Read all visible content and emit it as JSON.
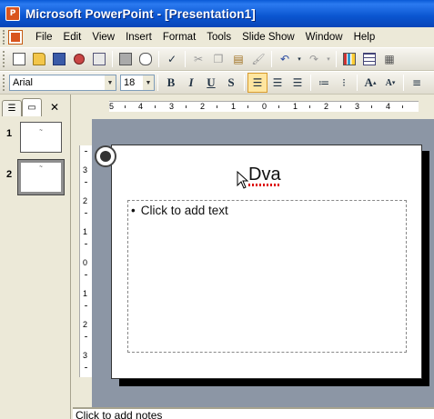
{
  "window": {
    "title": "Microsoft PowerPoint - [Presentation1]",
    "icon": "powerpoint-app-icon"
  },
  "menubar": {
    "items": [
      {
        "label": "File"
      },
      {
        "label": "Edit"
      },
      {
        "label": "View"
      },
      {
        "label": "Insert"
      },
      {
        "label": "Format"
      },
      {
        "label": "Tools"
      },
      {
        "label": "Slide Show"
      },
      {
        "label": "Window"
      },
      {
        "label": "Help"
      }
    ]
  },
  "toolbar_standard": {
    "icons": [
      "new-icon",
      "open-icon",
      "save-icon",
      "permission-icon",
      "email-icon",
      "print-icon",
      "print-preview-icon",
      "spelling-icon",
      "cut-icon",
      "copy-icon",
      "paste-icon",
      "format-painter-icon",
      "undo-icon",
      "redo-icon",
      "insert-chart-icon",
      "insert-table-icon",
      "tables-borders-icon"
    ]
  },
  "toolbar_formatting": {
    "font_name": "Arial",
    "font_size": "18",
    "bold": "B",
    "italic": "I",
    "underline": "U",
    "shadow": "S",
    "increase_font": "A",
    "decrease_font": "A"
  },
  "slides_pane": {
    "tabs": [
      "outline-tab-icon",
      "slides-tab-icon"
    ],
    "close": "✕",
    "slides": [
      {
        "number": "1",
        "thumb_text": "~"
      },
      {
        "number": "2",
        "thumb_text": "~"
      }
    ]
  },
  "ruler": {
    "horizontal": [
      "5",
      "4",
      "3",
      "2",
      "1",
      "0",
      "1",
      "2",
      "3",
      "4"
    ],
    "vertical": [
      "3",
      "2",
      "1",
      "0",
      "1",
      "2",
      "3"
    ]
  },
  "slide": {
    "title": "Dva",
    "body_placeholder": "Click to add text",
    "bullet": "•"
  },
  "notes": {
    "placeholder": "Click to add notes"
  },
  "colors": {
    "titlebar": "#0a55d0",
    "workspace": "#8c96a5",
    "chrome": "#ece9d8"
  }
}
